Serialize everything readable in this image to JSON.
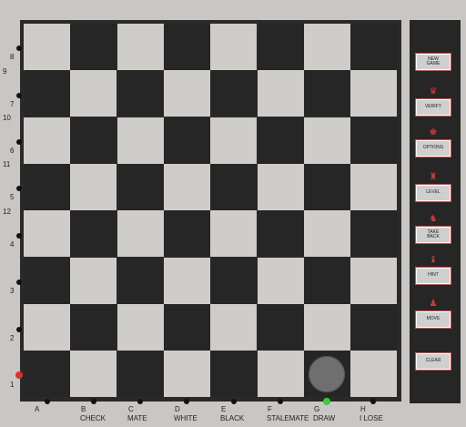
{
  "board": {
    "ranks": [
      "8",
      "7",
      "6",
      "5",
      "4",
      "3",
      "2",
      "1"
    ],
    "left_numbers": [
      "9",
      "10",
      "11",
      "12"
    ],
    "files": [
      "A",
      "B",
      "C",
      "D",
      "E",
      "F",
      "G",
      "H"
    ],
    "file_captions": [
      "",
      "CHECK",
      "MATE",
      "WHITE",
      "BLACK",
      "STALEMATE",
      "DRAW",
      "I LOSE"
    ]
  },
  "panel": {
    "buttons": [
      {
        "label": "NEW\nGAME",
        "icon": "none"
      },
      {
        "label": "VERIFY",
        "icon": "queen-icon"
      },
      {
        "label": "OPTIONS",
        "icon": "king-icon"
      },
      {
        "label": "LEVEL",
        "icon": "rook-icon"
      },
      {
        "label": "TAKE\nBACK",
        "icon": "knight-icon"
      },
      {
        "label": "HINT",
        "icon": "bishop-icon"
      },
      {
        "label": "MOVE",
        "icon": "pawn-icon"
      },
      {
        "label": "CLEAR",
        "icon": "none"
      }
    ]
  },
  "colors": {
    "light_square": "#cecdca",
    "dark_square": "#262626",
    "indicator_active": "#e03030",
    "indicator_selected": "#34d034",
    "button_border": "#d94a4a"
  },
  "selected_marker": {
    "square": "G1",
    "color": "#6f6f6f"
  }
}
